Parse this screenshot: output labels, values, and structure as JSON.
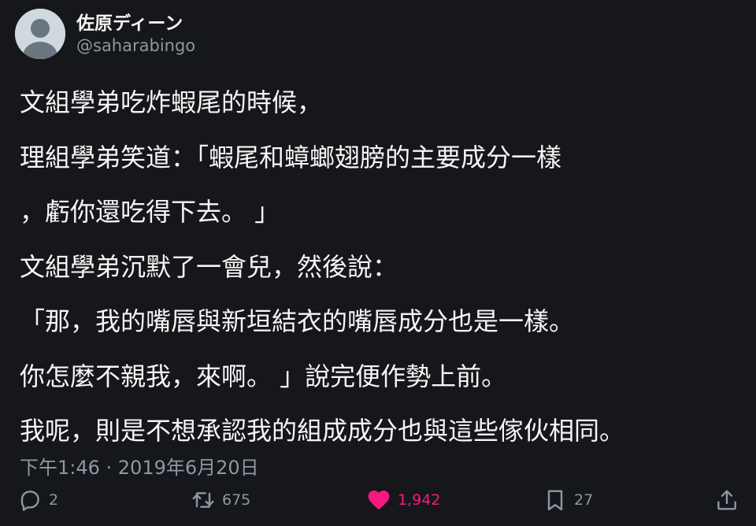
{
  "author": {
    "display_name": "佐原ディーン",
    "handle": "@saharabingo",
    "avatar_icon": "default-profile-icon"
  },
  "tweet": {
    "lines": [
      "文組學弟吃炸蝦尾的時候，",
      "理組學弟笑道：「蝦尾和蟑螂翅膀的主要成分一樣",
      "，虧你還吃得下去。 」",
      "文組學弟沉默了一會兒，然後說：",
      "「那，我的嘴唇與新垣結衣的嘴唇成分也是一樣。",
      "你怎麼不親我，來啊。 」說完便作勢上前。",
      "我呢，則是不想承認我的組成成分也與這些傢伙相同。"
    ],
    "timestamp": "下午1:46 · 2019年6月20日"
  },
  "actions": {
    "reply": {
      "icon": "reply-icon",
      "count": "2"
    },
    "retweet": {
      "icon": "retweet-icon",
      "count": "675"
    },
    "like": {
      "icon": "heart-icon",
      "count": "1,942",
      "color": "#f91880"
    },
    "bookmark": {
      "icon": "bookmark-icon",
      "count": "27"
    },
    "share": {
      "icon": "share-icon"
    }
  },
  "colors": {
    "background": "#15171a",
    "text": "#f5f5f5",
    "muted": "#8b98a5",
    "like": "#f91880"
  }
}
